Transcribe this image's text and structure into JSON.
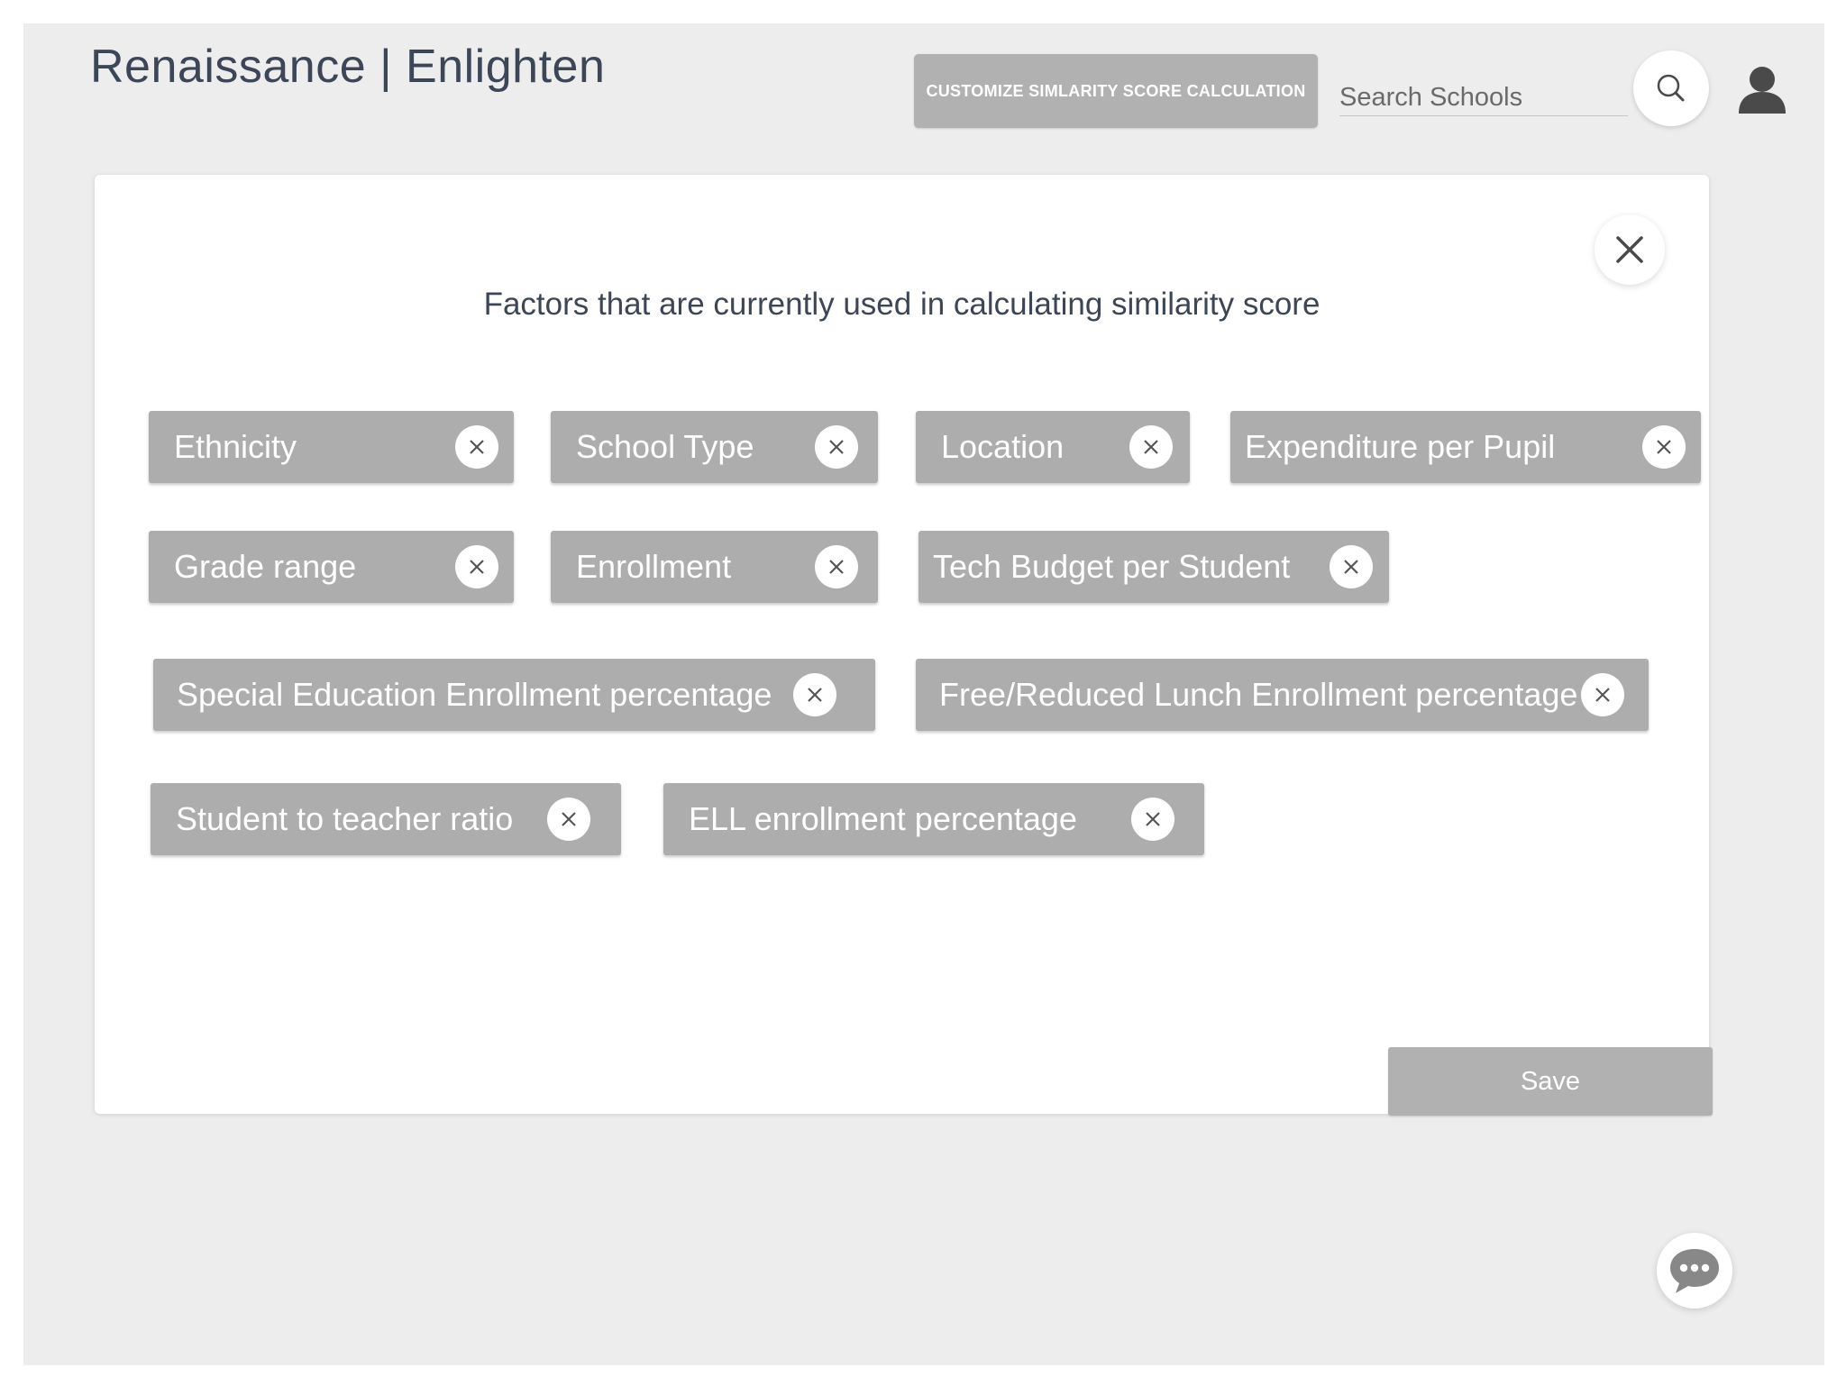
{
  "app": {
    "title": "Renaissance | Enlighten"
  },
  "header": {
    "customize_label": "CUSTOMIZE SIMLARITY SCORE CALCULATION",
    "search_placeholder": "Search Schools",
    "search_value": ""
  },
  "modal": {
    "heading": "Factors that are currently used in calculating similarity score",
    "factors": [
      "Ethnicity",
      "School Type",
      "Location",
      "Expenditure per Pupil",
      "Grade range",
      "Enrollment",
      "Tech Budget per Student",
      "Special Education Enrollment percentage",
      "Free/Reduced Lunch Enrollment percentage",
      "Student to teacher ratio",
      "ELL enrollment percentage"
    ],
    "save_label": "Save"
  },
  "icons": {
    "search": "search-icon",
    "user": "user-icon",
    "close": "close-icon",
    "remove": "remove-chip-icon",
    "chat": "chat-icon"
  },
  "colors": {
    "background": "#ededed",
    "chip": "#adadad",
    "button": "#b1b1b1",
    "title_text": "#3c4657"
  }
}
